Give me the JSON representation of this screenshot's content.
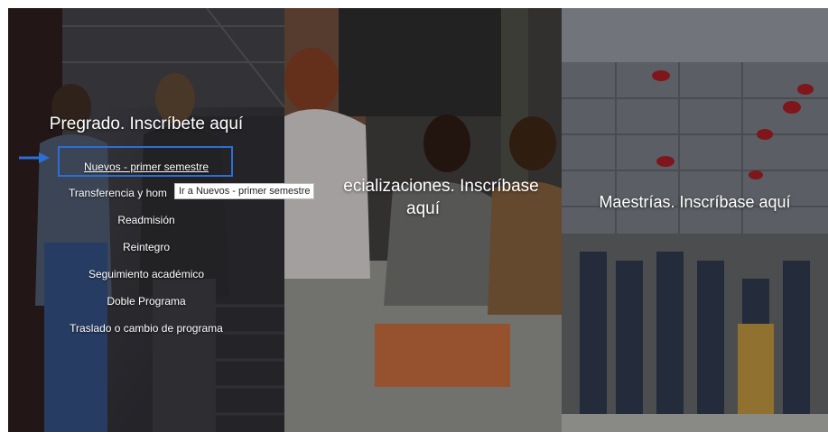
{
  "panels": {
    "pregrado": {
      "title": "Pregrado. Inscríbete aquí",
      "links": [
        "Nuevos - primer semestre",
        "Transferencia y hom",
        "Readmisión",
        "Reintegro",
        "Seguimiento académico",
        "Doble Programa",
        "Traslado o cambio de programa"
      ],
      "tooltip": "Ir a Nuevos - primer semestre"
    },
    "especializaciones": {
      "title_line1": "ecializaciones. Inscríbase",
      "title_line2": "aquí"
    },
    "maestrias": {
      "title": "Maestrías. Inscríbase aquí"
    }
  },
  "colors": {
    "focus": "#2a6fd6",
    "text": "#ffffff"
  },
  "icons": [
    "arrow-right-icon"
  ]
}
